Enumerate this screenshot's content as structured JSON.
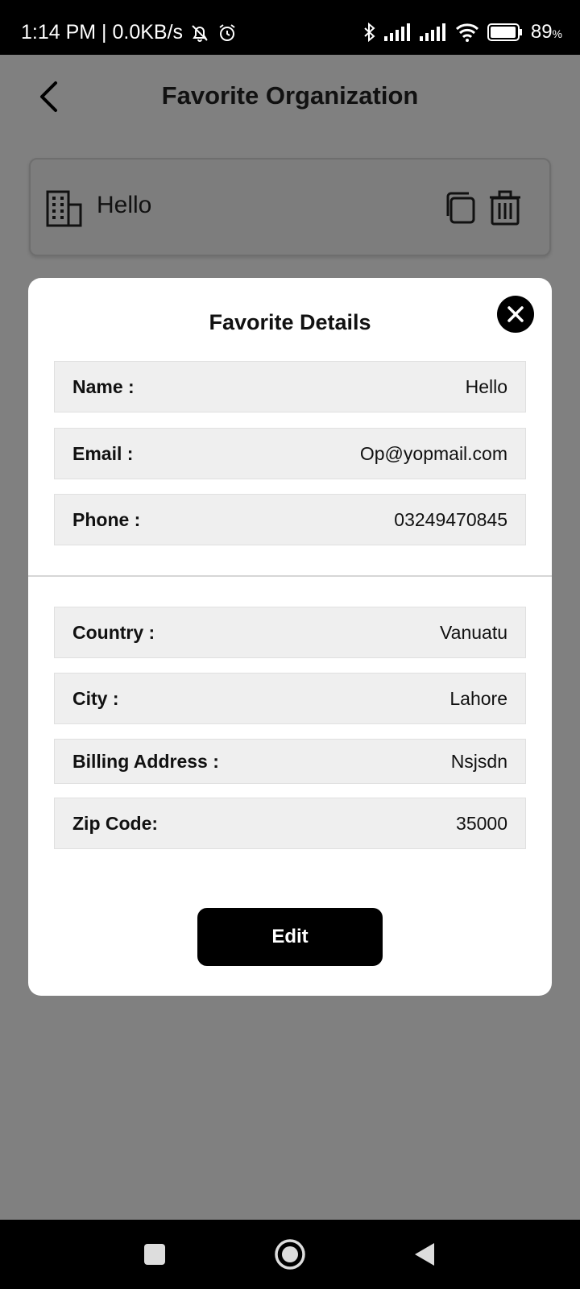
{
  "status_bar": {
    "time_speed": "1:14 PM | 0.0KB/s",
    "battery_percent": "89",
    "battery_unit": "%",
    "icons": [
      "bell-muted-icon",
      "alarm-icon",
      "bluetooth-icon",
      "signal-icon",
      "signal-icon",
      "wifi-icon",
      "battery-icon"
    ]
  },
  "header": {
    "title": "Favorite Organization",
    "back_icon": "chevron-left-icon"
  },
  "organization": {
    "name": "Hello",
    "icon": "building-icon",
    "actions": [
      "copy-icon",
      "trash-icon"
    ]
  },
  "modal": {
    "title": "Favorite Details",
    "close_icon": "close-icon",
    "contact": [
      {
        "label": "Name :",
        "value": "Hello"
      },
      {
        "label": "Email :",
        "value": "Op@yopmail.com"
      },
      {
        "label": "Phone :",
        "value": "03249470845"
      }
    ],
    "address": [
      {
        "label": "Country :",
        "value": "Vanuatu"
      },
      {
        "label": "City :",
        "value": "Lahore"
      },
      {
        "label": "Billing Address :",
        "value": "Nsjsdn"
      },
      {
        "label": "Zip Code:",
        "value": "35000"
      }
    ],
    "edit_label": "Edit"
  },
  "nav_bar": {
    "buttons": [
      "recents-icon",
      "home-icon",
      "back-icon"
    ]
  }
}
